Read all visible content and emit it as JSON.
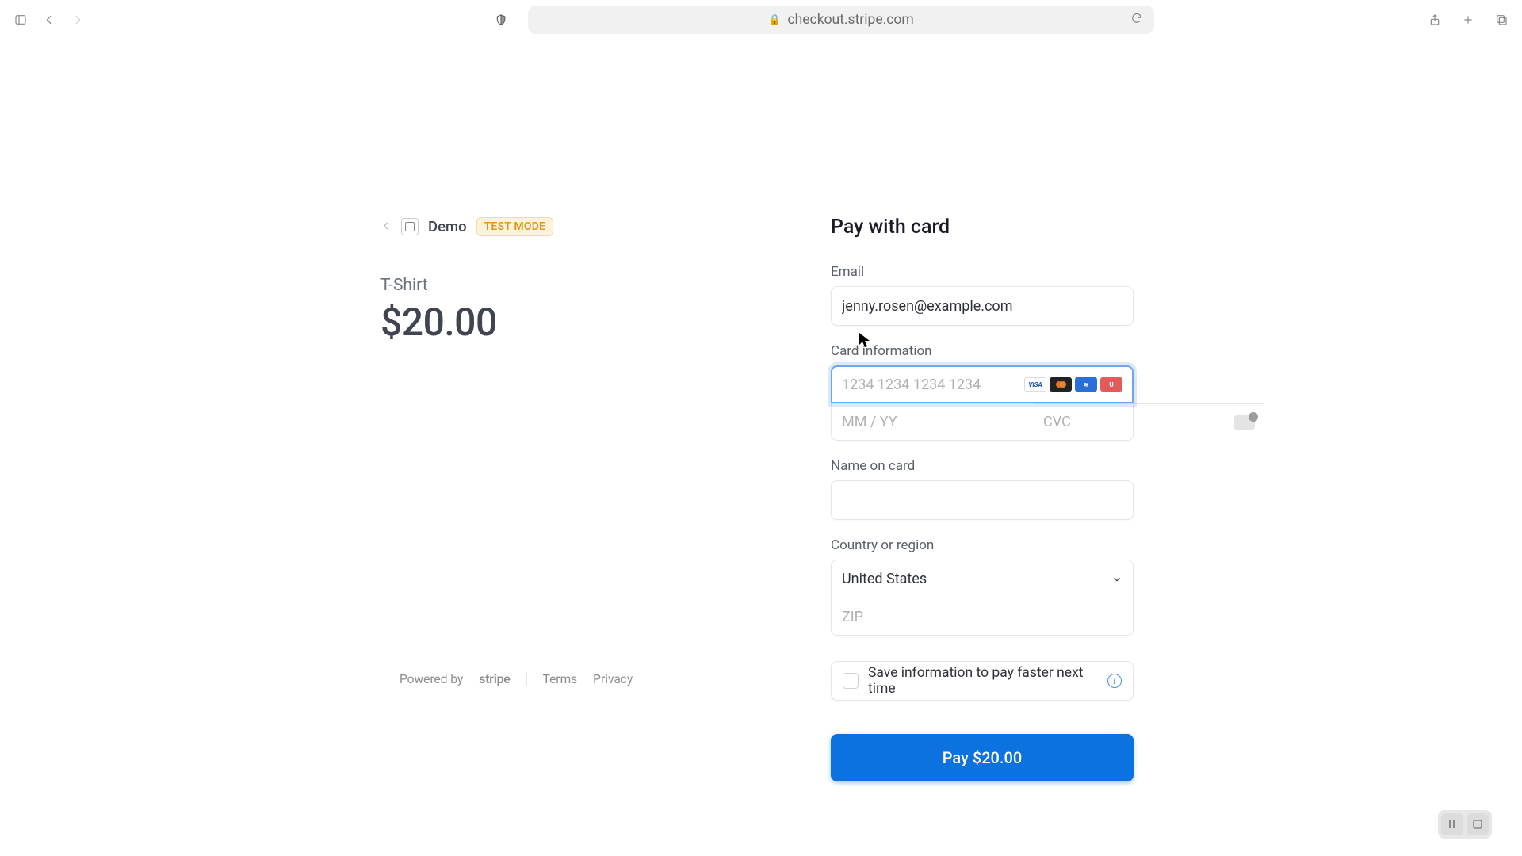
{
  "browser": {
    "url": "checkout.stripe.com"
  },
  "order": {
    "merchant": "Demo",
    "badge": "TEST MODE",
    "item_name": "T-Shirt",
    "item_price": "$20.00"
  },
  "footer": {
    "powered_by": "Powered by",
    "brand": "stripe",
    "terms": "Terms",
    "privacy": "Privacy"
  },
  "form": {
    "heading": "Pay with card",
    "email_label": "Email",
    "email_value": "jenny.rosen@example.com",
    "card_label": "Card information",
    "card_number_placeholder": "1234 1234 1234 1234",
    "exp_placeholder": "MM / YY",
    "cvc_placeholder": "CVC",
    "name_label": "Name on card",
    "country_label": "Country or region",
    "country_value": "United States",
    "zip_placeholder": "ZIP",
    "save_label": "Save information to pay faster next time",
    "pay_label": "Pay $20.00"
  },
  "card_brands": {
    "visa": "VISA",
    "paypal": "≋",
    "unionpay": "U"
  }
}
